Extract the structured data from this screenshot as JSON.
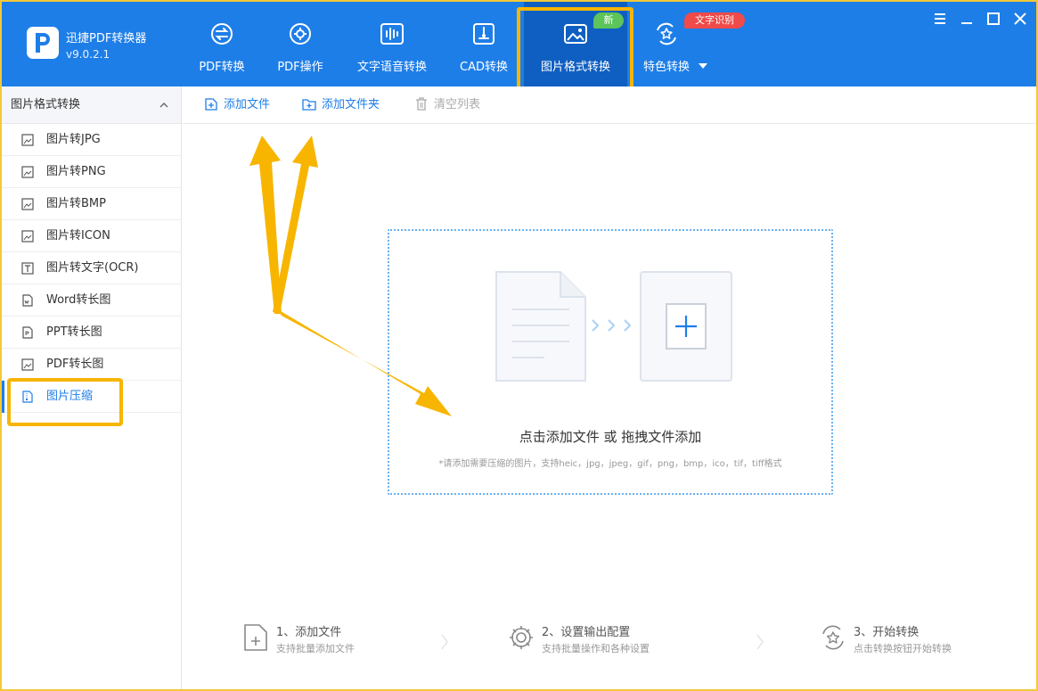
{
  "app": {
    "name": "迅捷PDF转换器",
    "version": "v9.0.2.1"
  },
  "nav": {
    "tabs": [
      {
        "label": "PDF转换",
        "icon": "exchange-circle-icon"
      },
      {
        "label": "PDF操作",
        "icon": "gear-circle-icon"
      },
      {
        "label": "文字语音转换",
        "icon": "waveform-icon"
      },
      {
        "label": "CAD转换",
        "icon": "cad-icon"
      },
      {
        "label": "图片格式转换",
        "icon": "image-icon",
        "active": true
      },
      {
        "label": "特色转换",
        "icon": "star-exchange-icon"
      }
    ],
    "badge_new": "新",
    "badge_ocr": "文字识别"
  },
  "sidebar": {
    "header": "图片格式转换",
    "items": [
      {
        "label": "图片转JPG"
      },
      {
        "label": "图片转PNG"
      },
      {
        "label": "图片转BMP"
      },
      {
        "label": "图片转ICON"
      },
      {
        "label": "图片转文字(OCR)"
      },
      {
        "label": "Word转长图"
      },
      {
        "label": "PPT转长图"
      },
      {
        "label": "PDF转长图"
      },
      {
        "label": "图片压缩",
        "active": true
      }
    ]
  },
  "toolbar": {
    "add_file": "添加文件",
    "add_folder": "添加文件夹",
    "clear_list": "清空列表"
  },
  "dropzone": {
    "title": "点击添加文件  或  拖拽文件添加",
    "hint": "*请添加需要压缩的图片，支持heic，jpg，jpeg，gif，png，bmp，ico，tif，tiff格式"
  },
  "steps": [
    {
      "title": "1、添加文件",
      "sub": "支持批量添加文件"
    },
    {
      "title": "2、设置输出配置",
      "sub": "支持批量操作和各种设置"
    },
    {
      "title": "3、开始转换",
      "sub": "点击转换按钮开始转换"
    }
  ],
  "colors": {
    "brand_blue": "#1e7ee8",
    "active_tab": "#0f5fc2",
    "highlight": "#f7b500",
    "badge_green": "#5cc45a",
    "badge_red": "#f04a4a"
  }
}
